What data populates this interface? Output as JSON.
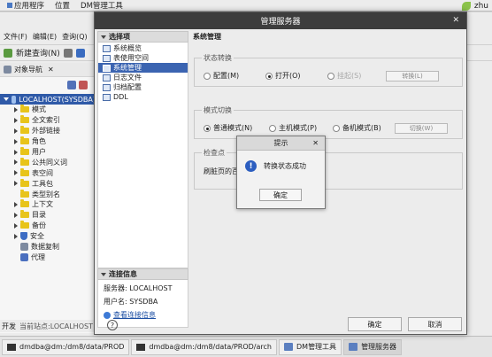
{
  "topbar": {
    "applications": "应用程序",
    "places": "位置",
    "app_name": "DM管理工具",
    "user": "zhu"
  },
  "bg": {
    "menu": [
      "文件(F)",
      "编辑(E)",
      "查询(Q)"
    ],
    "toolbar_new_query": "新建查询(N)",
    "nav_tab": "对象导航",
    "root": "LOCALHOST(SYSDBA)",
    "tree": [
      "模式",
      "全文索引",
      "外部链接",
      "角色",
      "用户",
      "公共同义词",
      "表空间",
      "工具包",
      "类型别名",
      "上下文",
      "目录",
      "备份",
      "安全",
      "数据复制",
      "代理"
    ],
    "status_label": "开发",
    "status_site": "当前站点:LOCALHOST"
  },
  "taskbar": {
    "items": [
      "dmdba@dm:/dm8/data/PROD",
      "dmdba@dm:/dm8/data/PROD/arch",
      "DM管理工具",
      "管理服务器"
    ]
  },
  "server_manager": {
    "title": "管理服务器",
    "options_header": "选择项",
    "options": [
      "系统概览",
      "表使用空间",
      "系统管理",
      "日志文件",
      "归档配置",
      "DDL"
    ],
    "conn_header": "连接信息",
    "server_label": "服务器: LOCALHOST",
    "user_label": "用户名: SYSDBA",
    "conn_link": "查看连接信息",
    "section_title": "系统管理",
    "state": {
      "title": "状态转换",
      "options": [
        "配置(M)",
        "打开(O)",
        "挂起(S)"
      ],
      "button": "转换(L)"
    },
    "mode": {
      "title": "模式切换",
      "options": [
        "普通模式(N)",
        "主机模式(P)",
        "备机模式(B)"
      ],
      "button": "切换(W)"
    },
    "checkpoint": {
      "title": "检查点",
      "label": "刷脏页的百"
    },
    "ok": "确定",
    "cancel": "取消"
  },
  "alert": {
    "title": "提示",
    "message": "转换状态成功",
    "ok": "确定",
    "icon": "info-icon"
  }
}
